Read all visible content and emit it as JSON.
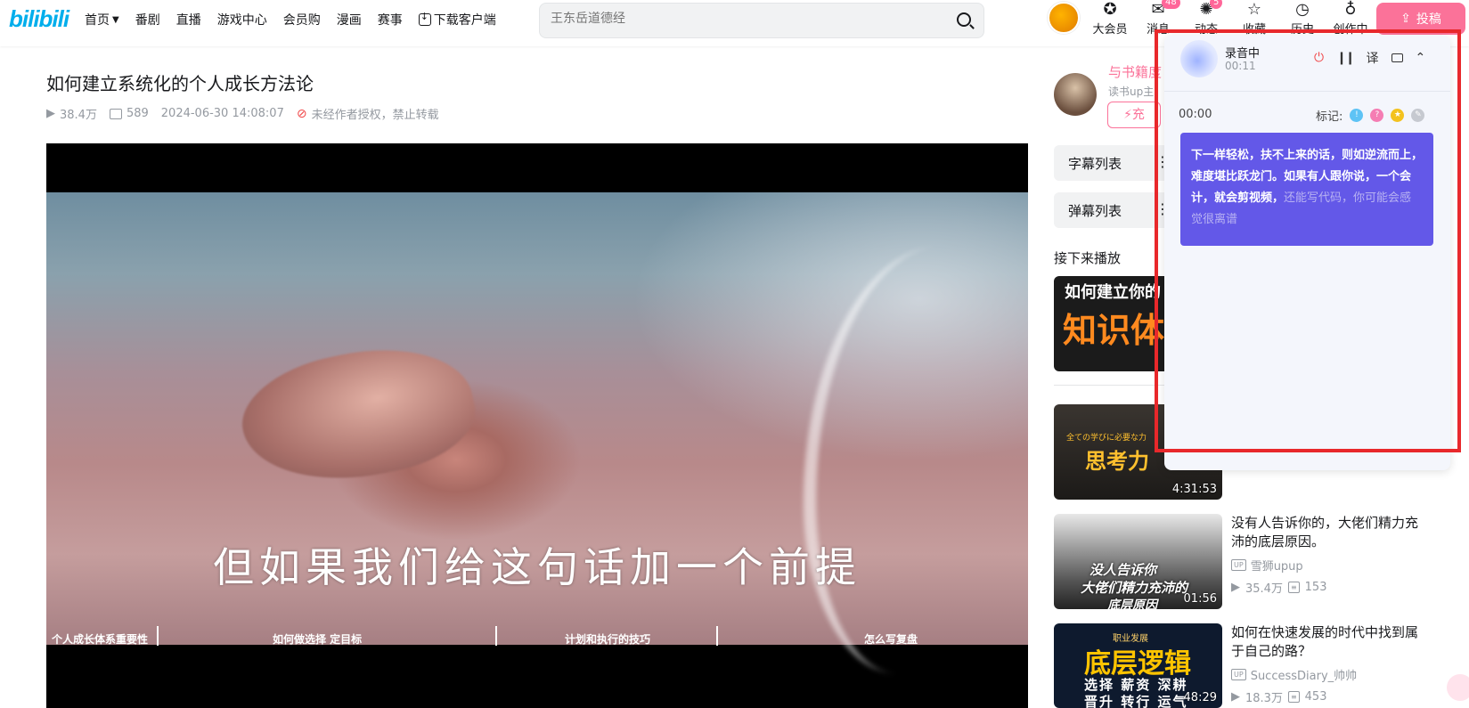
{
  "header": {
    "logo": "bilibili",
    "nav": [
      "首页",
      "番剧",
      "直播",
      "游戏中心",
      "会员购",
      "漫画",
      "赛事",
      "下载客户端"
    ],
    "search_placeholder": "王东岳道德经",
    "icons": [
      {
        "label": "大会员",
        "icon": "vip-icon",
        "glyph": "✪",
        "badge": ""
      },
      {
        "label": "消息",
        "icon": "message-icon",
        "glyph": "✉",
        "badge": "48"
      },
      {
        "label": "动态",
        "icon": "dynamic-icon",
        "glyph": "✺",
        "badge": "5"
      },
      {
        "label": "收藏",
        "icon": "favorite-icon",
        "glyph": "☆",
        "badge": ""
      },
      {
        "label": "历史",
        "icon": "history-icon",
        "glyph": "◷",
        "badge": ""
      },
      {
        "label": "创作中心",
        "icon": "creator-icon",
        "glyph": "♁",
        "badge": ""
      }
    ],
    "upload_label": "投稿"
  },
  "video": {
    "title": "如何建立系统化的个人成长方法论",
    "views": "38.4万",
    "danmaku": "589",
    "date": "2024-06-30 14:08:07",
    "copyright": "未经作者授权，禁止转载",
    "subtitle": "但如果我们给这句话加一个前提",
    "chapters": [
      "个人成长体系重要性",
      "如何做选择 定目标",
      "计划和执行的技巧",
      "怎么写复盘"
    ]
  },
  "uploader": {
    "name": "与书籍度",
    "desc": "读书up主",
    "charge_label": "充"
  },
  "sidebar": {
    "subtitle_list": "字幕列表",
    "danmaku_list": "弹幕列表",
    "next_label": "接下来播放",
    "thumb1_line1": "如何建立你的",
    "thumb1_line2": "知识体系",
    "thumb2_small": "全ての学びに必要な力",
    "thumb2_main": "思考力",
    "thumb2_duration": "4:31:53",
    "videos": [
      {
        "title": "没有人告诉你的，大佬们精力充沛的底层原因。",
        "author": "雪狮upup",
        "views": "35.4万",
        "danmaku": "153",
        "duration": "01:56",
        "thumb_lines": [
          "没人告诉你",
          "大佬们精力充沛的",
          "底层原因"
        ]
      },
      {
        "title": "如何在快速发展的时代中找到属于自己的路？",
        "author": "SuccessDiary_帅帅",
        "views": "18.3万",
        "danmaku": "453",
        "duration": "48:29",
        "thumb_lines": [
          "职业发展",
          "底层逻辑",
          "选择 薪资 深耕",
          "晋升 转行 运气"
        ]
      }
    ]
  },
  "recorder": {
    "status": "录音中",
    "elapsed": "00:11",
    "translate_label": "译",
    "timestamp": "00:00",
    "mark_label": "标记:",
    "transcript_main": "下一样轻松，扶不上来的话，则如逆流而上，难度堪比跃龙门。如果有人跟你说，一个会计，就会剪视频，",
    "transcript_pending": "还能写代码，你可能会感觉很离谱"
  },
  "colors": {
    "brand_blue": "#00aeec",
    "brand_pink": "#fb7299",
    "transcript_bg": "#6358e8",
    "highlight_frame": "#e8282b"
  }
}
